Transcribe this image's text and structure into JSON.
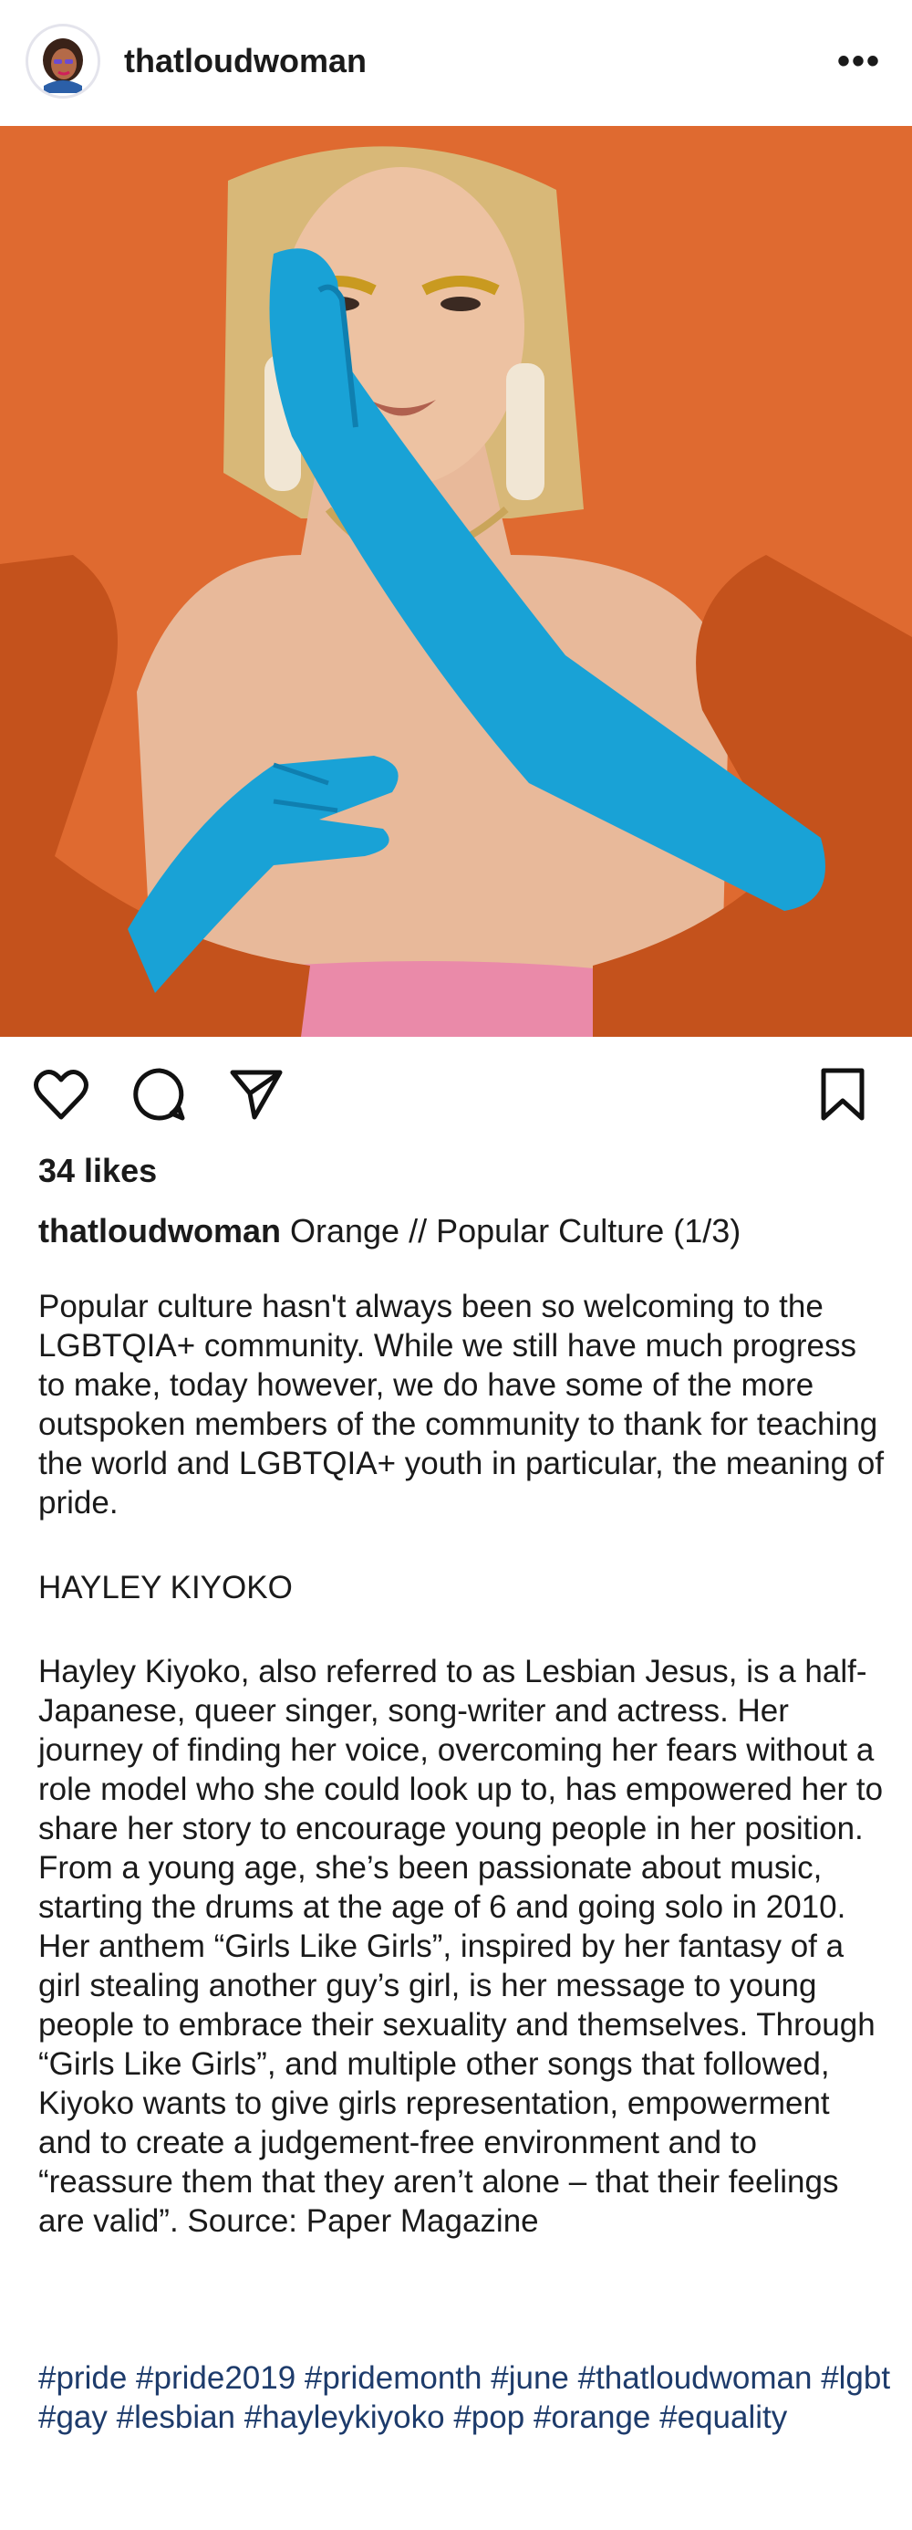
{
  "post": {
    "username": "thatloudwoman",
    "more_label": "•••",
    "likes": "34 likes",
    "caption_title": "Orange // Popular Culture (1/3)",
    "paragraph1": "Popular culture hasn't always been so welcoming to the LGBTQIA+ community. While we still have much progress to make, today however, we do have some of the more outspoken members of the community to thank for teaching the world and LGBTQIA+ youth in particular, the meaning of pride.",
    "heading": "HAYLEY KIYOKO",
    "paragraph2": "Hayley Kiyoko, also referred to as Lesbian Jesus, is a half-Japanese, queer singer, song-writer and actress. Her journey of finding her voice, overcoming her fears without a role model who she could look up to, has empowered her to share her story to encourage young people in her position. From a young age, she’s been passionate about music, starting the drums at the age of 6 and going solo in 2010. Her anthem “Girls Like Girls”, inspired by her fantasy of a girl stealing another guy’s girl, is her message to young people to embrace their sexuality and themselves. Through “Girls Like Girls”, and multiple other songs that followed, Kiyoko wants to give girls representation, empowerment and to create a judgement-free environment and to “reassure them that they aren’t alone – that their feelings are valid”. Source: Paper Magazine",
    "hashtags": [
      "#pride",
      "#pride2019",
      "#pridemonth",
      "#june",
      "#thatloudwoman",
      "#lgbt",
      "#gay",
      "#lesbian",
      "#hayleykiyoko",
      "#pop",
      "#orange",
      "#equality"
    ]
  },
  "icons": {
    "like": "heart-icon",
    "comment": "comment-icon",
    "share": "send-icon",
    "save": "bookmark-icon",
    "more": "more-icon"
  },
  "colors": {
    "photo_background": "#df6a30",
    "glove_blue": "#19a2d6",
    "sleeve_orange": "#c4521c",
    "hashtag": "#1d3b6b"
  }
}
